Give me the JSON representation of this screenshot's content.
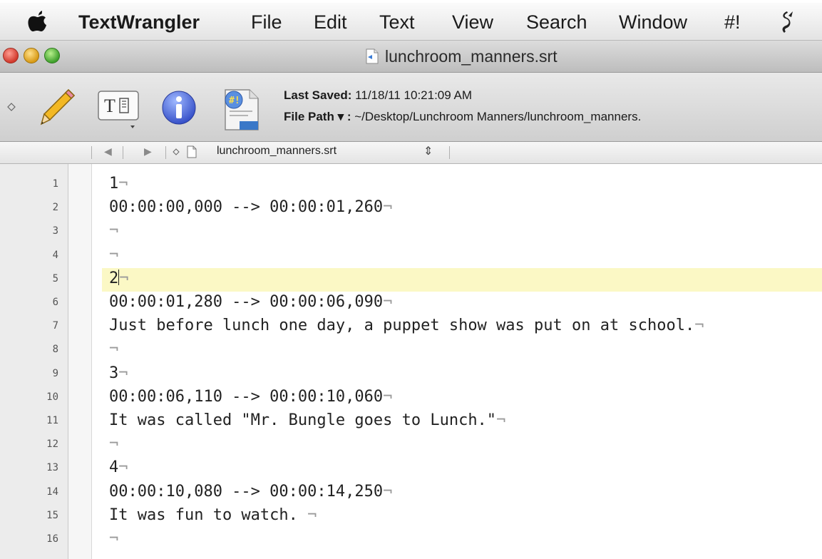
{
  "menubar": {
    "app_name": "TextWrangler",
    "items": [
      "File",
      "Edit",
      "Text",
      "View",
      "Search",
      "Window",
      "#!"
    ]
  },
  "window": {
    "title": "lunchroom_manners.srt"
  },
  "toolbar": {
    "last_saved_label": "Last Saved:",
    "last_saved_value": "11/18/11 10:21:09 AM",
    "file_path_label": "File Path ▾ :",
    "file_path_value": "~/Desktop/Lunchroom Manners/lunchroom_manners."
  },
  "navbar": {
    "filename": "lunchroom_manners.srt"
  },
  "editor": {
    "eol_marker": "¬",
    "current_line": 5,
    "lines": [
      {
        "num": "1",
        "text": "1"
      },
      {
        "num": "2",
        "text": "00:00:00,000 --> 00:00:01,260"
      },
      {
        "num": "3",
        "text": ""
      },
      {
        "num": "4",
        "text": ""
      },
      {
        "num": "5",
        "text": "2"
      },
      {
        "num": "6",
        "text": "00:00:01,280 --> 00:00:06,090"
      },
      {
        "num": "7",
        "text": "Just before lunch one day, a puppet show was put on at school."
      },
      {
        "num": "8",
        "text": ""
      },
      {
        "num": "9",
        "text": "3"
      },
      {
        "num": "10",
        "text": "00:00:06,110 --> 00:00:10,060"
      },
      {
        "num": "11",
        "text": "It was called \"Mr. Bungle goes to Lunch.\""
      },
      {
        "num": "12",
        "text": ""
      },
      {
        "num": "13",
        "text": "4"
      },
      {
        "num": "14",
        "text": "00:00:10,080 --> 00:00:14,250"
      },
      {
        "num": "15",
        "text": "It was fun to watch. "
      },
      {
        "num": "16",
        "text": ""
      }
    ]
  },
  "colors": {
    "current_line_highlight": "#fbf8c5",
    "gutter": "#ececec"
  }
}
